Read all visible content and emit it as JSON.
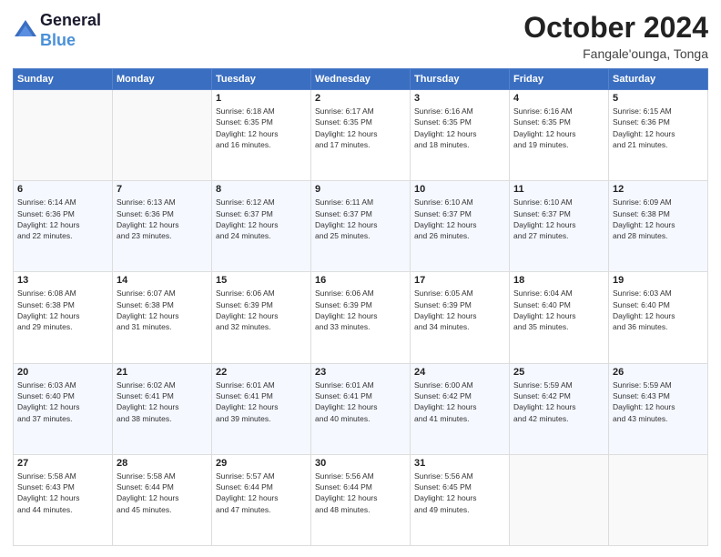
{
  "logo": {
    "line1": "General",
    "line2": "Blue"
  },
  "title": "October 2024",
  "subtitle": "Fangale'ounga, Tonga",
  "days": [
    "Sunday",
    "Monday",
    "Tuesday",
    "Wednesday",
    "Thursday",
    "Friday",
    "Saturday"
  ],
  "weeks": [
    [
      {
        "day": "",
        "content": ""
      },
      {
        "day": "",
        "content": ""
      },
      {
        "day": "1",
        "content": "Sunrise: 6:18 AM\nSunset: 6:35 PM\nDaylight: 12 hours\nand 16 minutes."
      },
      {
        "day": "2",
        "content": "Sunrise: 6:17 AM\nSunset: 6:35 PM\nDaylight: 12 hours\nand 17 minutes."
      },
      {
        "day": "3",
        "content": "Sunrise: 6:16 AM\nSunset: 6:35 PM\nDaylight: 12 hours\nand 18 minutes."
      },
      {
        "day": "4",
        "content": "Sunrise: 6:16 AM\nSunset: 6:35 PM\nDaylight: 12 hours\nand 19 minutes."
      },
      {
        "day": "5",
        "content": "Sunrise: 6:15 AM\nSunset: 6:36 PM\nDaylight: 12 hours\nand 21 minutes."
      }
    ],
    [
      {
        "day": "6",
        "content": "Sunrise: 6:14 AM\nSunset: 6:36 PM\nDaylight: 12 hours\nand 22 minutes."
      },
      {
        "day": "7",
        "content": "Sunrise: 6:13 AM\nSunset: 6:36 PM\nDaylight: 12 hours\nand 23 minutes."
      },
      {
        "day": "8",
        "content": "Sunrise: 6:12 AM\nSunset: 6:37 PM\nDaylight: 12 hours\nand 24 minutes."
      },
      {
        "day": "9",
        "content": "Sunrise: 6:11 AM\nSunset: 6:37 PM\nDaylight: 12 hours\nand 25 minutes."
      },
      {
        "day": "10",
        "content": "Sunrise: 6:10 AM\nSunset: 6:37 PM\nDaylight: 12 hours\nand 26 minutes."
      },
      {
        "day": "11",
        "content": "Sunrise: 6:10 AM\nSunset: 6:37 PM\nDaylight: 12 hours\nand 27 minutes."
      },
      {
        "day": "12",
        "content": "Sunrise: 6:09 AM\nSunset: 6:38 PM\nDaylight: 12 hours\nand 28 minutes."
      }
    ],
    [
      {
        "day": "13",
        "content": "Sunrise: 6:08 AM\nSunset: 6:38 PM\nDaylight: 12 hours\nand 29 minutes."
      },
      {
        "day": "14",
        "content": "Sunrise: 6:07 AM\nSunset: 6:38 PM\nDaylight: 12 hours\nand 31 minutes."
      },
      {
        "day": "15",
        "content": "Sunrise: 6:06 AM\nSunset: 6:39 PM\nDaylight: 12 hours\nand 32 minutes."
      },
      {
        "day": "16",
        "content": "Sunrise: 6:06 AM\nSunset: 6:39 PM\nDaylight: 12 hours\nand 33 minutes."
      },
      {
        "day": "17",
        "content": "Sunrise: 6:05 AM\nSunset: 6:39 PM\nDaylight: 12 hours\nand 34 minutes."
      },
      {
        "day": "18",
        "content": "Sunrise: 6:04 AM\nSunset: 6:40 PM\nDaylight: 12 hours\nand 35 minutes."
      },
      {
        "day": "19",
        "content": "Sunrise: 6:03 AM\nSunset: 6:40 PM\nDaylight: 12 hours\nand 36 minutes."
      }
    ],
    [
      {
        "day": "20",
        "content": "Sunrise: 6:03 AM\nSunset: 6:40 PM\nDaylight: 12 hours\nand 37 minutes."
      },
      {
        "day": "21",
        "content": "Sunrise: 6:02 AM\nSunset: 6:41 PM\nDaylight: 12 hours\nand 38 minutes."
      },
      {
        "day": "22",
        "content": "Sunrise: 6:01 AM\nSunset: 6:41 PM\nDaylight: 12 hours\nand 39 minutes."
      },
      {
        "day": "23",
        "content": "Sunrise: 6:01 AM\nSunset: 6:41 PM\nDaylight: 12 hours\nand 40 minutes."
      },
      {
        "day": "24",
        "content": "Sunrise: 6:00 AM\nSunset: 6:42 PM\nDaylight: 12 hours\nand 41 minutes."
      },
      {
        "day": "25",
        "content": "Sunrise: 5:59 AM\nSunset: 6:42 PM\nDaylight: 12 hours\nand 42 minutes."
      },
      {
        "day": "26",
        "content": "Sunrise: 5:59 AM\nSunset: 6:43 PM\nDaylight: 12 hours\nand 43 minutes."
      }
    ],
    [
      {
        "day": "27",
        "content": "Sunrise: 5:58 AM\nSunset: 6:43 PM\nDaylight: 12 hours\nand 44 minutes."
      },
      {
        "day": "28",
        "content": "Sunrise: 5:58 AM\nSunset: 6:44 PM\nDaylight: 12 hours\nand 45 minutes."
      },
      {
        "day": "29",
        "content": "Sunrise: 5:57 AM\nSunset: 6:44 PM\nDaylight: 12 hours\nand 47 minutes."
      },
      {
        "day": "30",
        "content": "Sunrise: 5:56 AM\nSunset: 6:44 PM\nDaylight: 12 hours\nand 48 minutes."
      },
      {
        "day": "31",
        "content": "Sunrise: 5:56 AM\nSunset: 6:45 PM\nDaylight: 12 hours\nand 49 minutes."
      },
      {
        "day": "",
        "content": ""
      },
      {
        "day": "",
        "content": ""
      }
    ]
  ]
}
